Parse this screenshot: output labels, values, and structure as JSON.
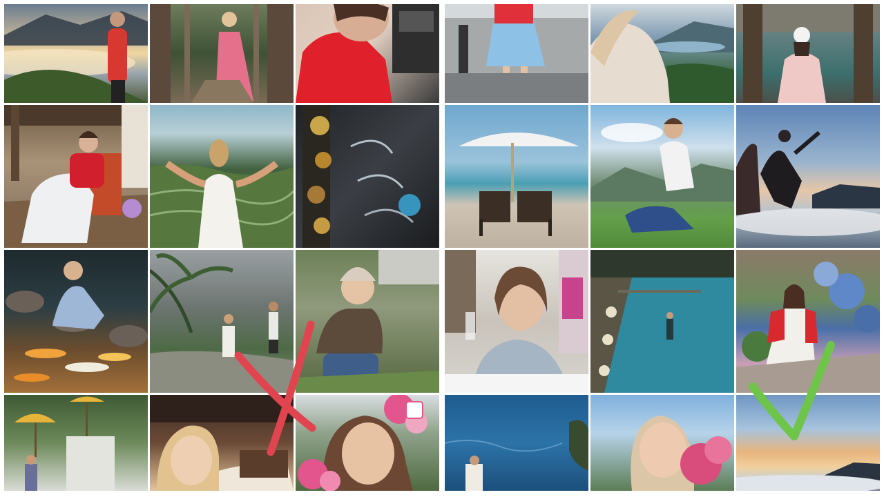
{
  "collage": {
    "left_grid": [
      {
        "id": "sunrise",
        "label": ""
      },
      {
        "id": "forest-bridge",
        "label": ""
      },
      {
        "id": "red-hoodie-selfie",
        "label": ""
      },
      {
        "id": "veranda-chair",
        "label": ""
      },
      {
        "id": "rice-terrace",
        "label": ""
      },
      {
        "id": "temple-fountain",
        "label": ""
      },
      {
        "id": "koi-pond",
        "label": ""
      },
      {
        "id": "palm-couple",
        "label": ""
      },
      {
        "id": "toddler",
        "label": ""
      },
      {
        "id": "garden-umbrella",
        "label": ""
      },
      {
        "id": "blonde-portrait",
        "label": ""
      },
      {
        "id": "flowers-smile",
        "label": ""
      }
    ],
    "right_grid": [
      {
        "id": "seawall",
        "label": ""
      },
      {
        "id": "lake-view",
        "label": ""
      },
      {
        "id": "venice-pier",
        "label": ""
      },
      {
        "id": "beach-umbrella",
        "label": ""
      },
      {
        "id": "hills-sitting",
        "label": ""
      },
      {
        "id": "sunrise-jump",
        "label": ""
      },
      {
        "id": "dinner-toast",
        "label": ""
      },
      {
        "id": "temple-pools",
        "label": ""
      },
      {
        "id": "hydrangea",
        "label": ""
      },
      {
        "id": "ocean-cliff",
        "label": ""
      },
      {
        "id": "peony-smell",
        "label": ""
      },
      {
        "id": "sunset-clouds",
        "label": ""
      }
    ]
  },
  "marks": {
    "cross_color": "#e0454f",
    "check_color": "#6fc44a"
  }
}
